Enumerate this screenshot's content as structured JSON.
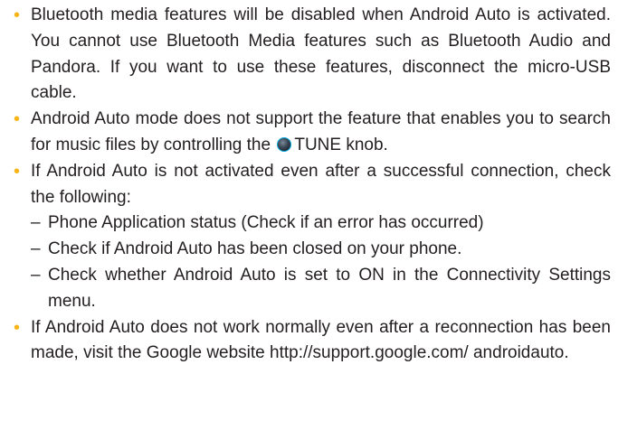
{
  "bullets": [
    {
      "text": "Bluetooth media features will be disabled when Android Auto is activated. You cannot use Bluetooth Media features such as Bluetooth Audio and Pandora. If you want to use these features, disconnect the micro-USB cable."
    },
    {
      "text_before_icon": "Android Auto mode does not support the feature that enables you to search for music files by controlling the",
      "icon": "tune-knob-icon",
      "text_after_icon": "TUNE knob."
    },
    {
      "text": "If Android Auto is not activated even after a successful connection, check the following:",
      "sub_items": [
        "Phone Application status (Check if an error has occurred)",
        "Check if Android Auto has been closed on your phone.",
        "Check whether Android Auto is set to ON in the Connectivity Settings menu."
      ]
    },
    {
      "text": "If Android Auto does not work normally even after a reconnection has been made, visit the Google website http://support.google.com/ androidauto."
    }
  ],
  "bullet_symbol": "•",
  "sub_symbol": "–",
  "colors": {
    "bullet": "#f7b518",
    "text": "#231f20",
    "knob_ring": "#00a7dd"
  }
}
